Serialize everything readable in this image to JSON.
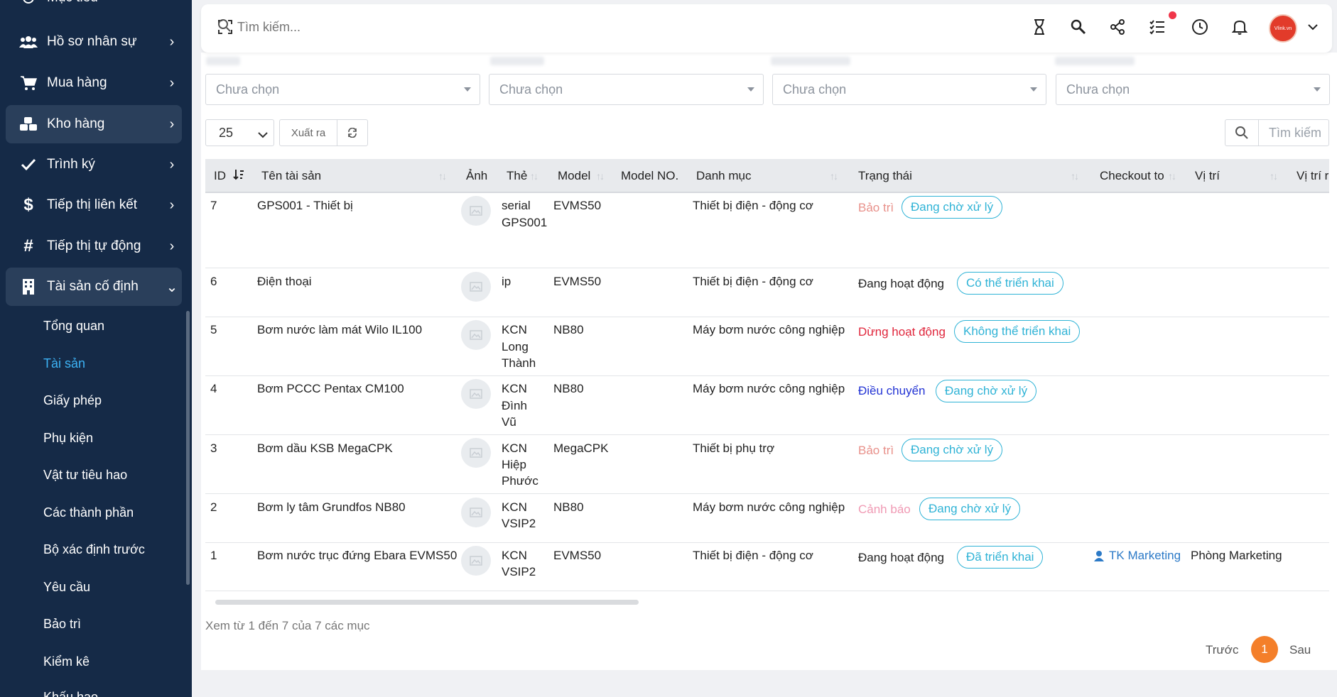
{
  "sidebar": {
    "top_partial": "Mục tiêu",
    "items": [
      {
        "label": "Hồ sơ nhân sự",
        "icon": "users-icon"
      },
      {
        "label": "Mua hàng",
        "icon": "cart-icon"
      },
      {
        "label": "Kho hàng",
        "icon": "boxes-icon"
      },
      {
        "label": "Trình ký",
        "icon": "check-icon"
      },
      {
        "label": "Tiếp thị liên kết",
        "icon": "dollar-icon"
      },
      {
        "label": "Tiếp thị tự động",
        "icon": "hash-icon"
      },
      {
        "label": "Tài sản cố định",
        "icon": "building-icon"
      }
    ],
    "subitems": [
      "Tổng quan",
      "Tài sản",
      "Giấy phép",
      "Phụ kiện",
      "Vật tư tiêu hao",
      "Các thành phần",
      "Bộ xác định trước",
      "Yêu cầu",
      "Bảo trì",
      "Kiểm kê",
      "Khấu hao"
    ]
  },
  "header": {
    "search_placeholder": "Tìm kiếm...",
    "avatar_text": "Vlink.vn"
  },
  "filters": [
    "Chưa chọn",
    "Chưa chọn",
    "Chưa chọn",
    "Chưa chọn"
  ],
  "toolbar": {
    "page_size": "25",
    "export_label": "Xuất ra",
    "search_placeholder": "Tìm kiếm"
  },
  "table": {
    "columns": [
      "ID",
      "Tên tài sản",
      "Ảnh",
      "Thẻ",
      "Model",
      "Model NO.",
      "Danh mục",
      "Trạng thái",
      "Checkout to",
      "Vị trí",
      "Vị trí r"
    ],
    "rows": [
      {
        "id": "7",
        "name": "GPS001 - Thiết bị",
        "tag": [
          "serial",
          "GPS001"
        ],
        "model": "EVMS50",
        "category": "Thiết bị điện - động cơ",
        "status": "Bảo trì",
        "status_color": "#e8908a",
        "pill": "Đang chờ xử lý",
        "checkout": "",
        "location": ""
      },
      {
        "id": "6",
        "name": "Điện thoại",
        "tag": [
          "ip"
        ],
        "model": "EVMS50",
        "category": "Thiết bị điện - động cơ",
        "status": "Đang hoạt động",
        "status_color": "#222222",
        "pill": "Có thể triển khai",
        "checkout": "",
        "location": ""
      },
      {
        "id": "5",
        "name": "Bơm nước làm mát Wilo IL100",
        "tag": [
          "KCN",
          "Long",
          "Thành"
        ],
        "model": "NB80",
        "category": "Máy bơm nước công nghiệp",
        "status": "Dừng hoạt động",
        "status_color": "#e0263c",
        "pill": "Không thể triển khai",
        "checkout": "",
        "location": ""
      },
      {
        "id": "4",
        "name": "Bơm PCCC Pentax CM100",
        "tag": [
          "KCN",
          "Đình",
          "Vũ"
        ],
        "model": "NB80",
        "category": "Máy bơm nước công nghiệp",
        "status": "Điều chuyển",
        "status_color": "#2233d4",
        "pill": "Đang chờ xử lý",
        "checkout": "",
        "location": ""
      },
      {
        "id": "3",
        "name": "Bơm dầu KSB MegaCPK",
        "tag": [
          "KCN",
          "Hiệp",
          "Phước"
        ],
        "model": "MegaCPK",
        "category": "Thiết bị phụ trợ",
        "status": "Bảo trì",
        "status_color": "#e8908a",
        "pill": "Đang chờ xử lý",
        "checkout": "",
        "location": ""
      },
      {
        "id": "2",
        "name": "Bơm ly tâm Grundfos NB80",
        "tag": [
          "KCN",
          "VSIP2"
        ],
        "model": "NB80",
        "category": "Máy bơm nước công nghiệp",
        "status": "Cảnh báo",
        "status_color": "#f09ab4",
        "pill": "Đang chờ xử lý",
        "checkout": "",
        "location": ""
      },
      {
        "id": "1",
        "name": "Bơm nước trục đứng Ebara EVMS50",
        "tag": [
          "KCN",
          "VSIP2"
        ],
        "model": "EVMS50",
        "category": "Thiết bị điện - động cơ",
        "status": "Đang hoạt động",
        "status_color": "#222222",
        "pill": "Đã triển khai",
        "checkout": "TK Marketing",
        "location": "Phòng Marketing"
      }
    ]
  },
  "footer": {
    "summary": "Xem từ 1 đến 7 của 7 các mục",
    "prev": "Trước",
    "page": "1",
    "next": "Sau"
  }
}
